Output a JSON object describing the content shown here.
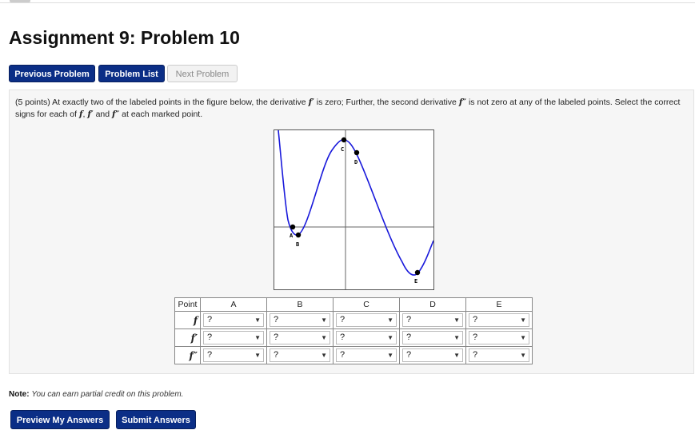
{
  "title": "Assignment 9: Problem 10",
  "nav": {
    "previous": "Previous Problem",
    "list": "Problem List",
    "next": "Next Problem"
  },
  "problem": {
    "points": "(5 points)",
    "text_1": "At exactly two of the labeled points in the figure below, the derivative",
    "f_prime": "f′",
    "text_2": "is zero; Further, the second derivative",
    "f_double_prime": "f″",
    "text_3": "is not zero at any of the labeled points. Select the correct signs for each of",
    "f": "f",
    "sep_1": ",",
    "and": "and",
    "text_4": "at each marked point."
  },
  "graph": {
    "points": [
      {
        "label": "A"
      },
      {
        "label": "B"
      },
      {
        "label": "C"
      },
      {
        "label": "D"
      },
      {
        "label": "E"
      }
    ]
  },
  "table": {
    "header_point": "Point",
    "columns": [
      "A",
      "B",
      "C",
      "D",
      "E"
    ],
    "rows": [
      {
        "label": "f",
        "values": [
          "?",
          "?",
          "?",
          "?",
          "?"
        ]
      },
      {
        "label": "f′",
        "values": [
          "?",
          "?",
          "?",
          "?",
          "?"
        ]
      },
      {
        "label": "f″",
        "values": [
          "?",
          "?",
          "?",
          "?",
          "?"
        ]
      }
    ],
    "dropdown_arrow": "▼"
  },
  "note": {
    "label": "Note:",
    "text": "You can earn partial credit on this problem."
  },
  "actions": {
    "preview": "Preview My Answers",
    "submit": "Submit Answers"
  },
  "colors": {
    "button_primary": "#0b2e86",
    "curve": "#1a1adb",
    "panel_bg": "#f6f6f6"
  }
}
